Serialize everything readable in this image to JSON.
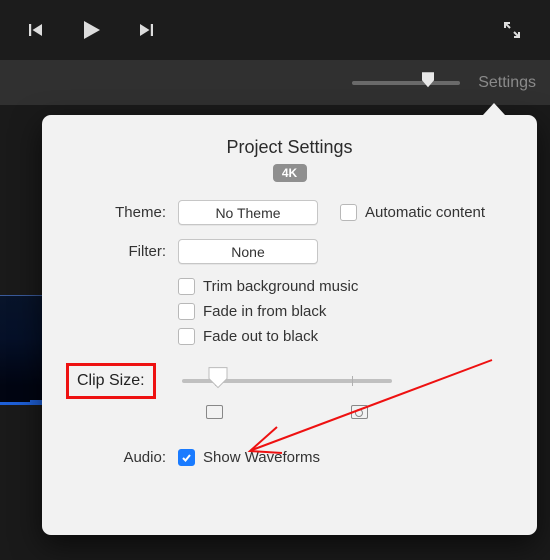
{
  "playback": {},
  "secondary": {
    "settings_label": "Settings"
  },
  "popover": {
    "title": "Project Settings",
    "badge": "4K",
    "theme": {
      "label": "Theme:",
      "value": "No Theme"
    },
    "automatic_content": {
      "label": "Automatic content",
      "checked": false
    },
    "filter": {
      "label": "Filter:",
      "value": "None"
    },
    "opts": {
      "trim": {
        "label": "Trim background music",
        "checked": false
      },
      "fade_in": {
        "label": "Fade in from black",
        "checked": false
      },
      "fade_out": {
        "label": "Fade out to black",
        "checked": false
      }
    },
    "clip_size": {
      "label": "Clip Size:"
    },
    "audio": {
      "label": "Audio:",
      "waveforms_label": "Show Waveforms",
      "waveforms_checked": true
    }
  },
  "annotation": {
    "highlight": "Clip Size"
  }
}
